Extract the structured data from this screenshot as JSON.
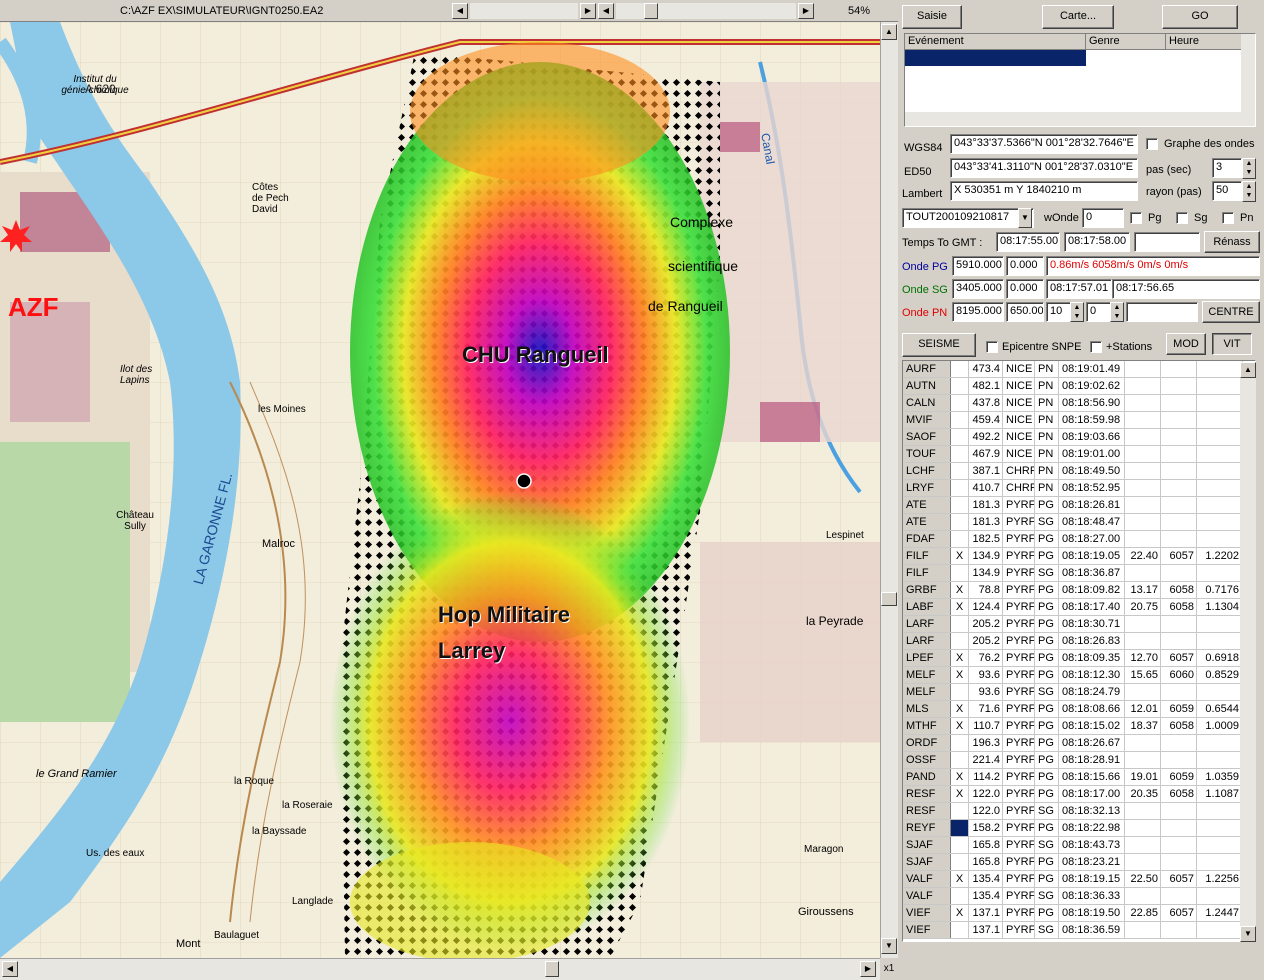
{
  "titlebar": {
    "path": "C:\\AZF EX\\SIMULATEUR\\IGNT0250.EA2",
    "zoom": "54%",
    "zoom_factor": "x1"
  },
  "map": {
    "labels": {
      "azf": "AZF",
      "chu": "CHU Rangueil",
      "hop1": "Hop Militaire",
      "hop2": "Larrey",
      "garonne": "LA GARONNE FL.",
      "a620": "A 620",
      "institut": "Institut du génie chimique",
      "ilot": "Ilot des Lapins",
      "chateau": "Château Sully",
      "malroc": "Malroc",
      "moines": "les Moines",
      "laroque": "la Roque",
      "roseraie": "la Roseraie",
      "bayssade": "la Bayssade",
      "grandramier": "le Grand Ramier",
      "baulaguet": "Baulaguet",
      "langlade": "Langlade",
      "giroussens": "Giroussens",
      "maragon": "Maragon",
      "peyrade": "la Peyrade",
      "lespinet": "Lespinet",
      "complexe": "Complexe",
      "scientifique": "scientifique",
      "rangueil": "de Rangueil",
      "canal": "Canal",
      "cotes": "Côtes de Pech David",
      "usdeseaux": "Us. des eaux",
      "mont": "Mont"
    }
  },
  "buttons": {
    "saisie": "Saisie",
    "carte": "Carte...",
    "go": "GO",
    "renass": "Rénass",
    "centre": "CENTRE",
    "seisme": "SEISME",
    "mod": "MOD",
    "vit": "VIT"
  },
  "events": {
    "col_event": "Evénement",
    "col_genre": "Genre",
    "col_heure": "Heure"
  },
  "coords": {
    "wgs84_label": "WGS84",
    "wgs84": "043°33'37.5366\"N 001°28'32.7646\"E",
    "ed50_label": "ED50",
    "ed50": "043°33'41.3110\"N 001°28'37.0310\"E",
    "lambert_label": "Lambert",
    "lambert": "X 530351 m Y 1840210 m",
    "graphe": "Graphe des ondes",
    "pas_label": "pas (sec)",
    "pas": "3",
    "rayon_label": "rayon (pas)",
    "rayon": "50"
  },
  "filter": {
    "select": "TOUT200109210817",
    "wonde_label": "wOnde",
    "wonde": "0",
    "pg": "Pg",
    "sg": "Sg",
    "pn": "Pn"
  },
  "time": {
    "label": "Temps To GMT :",
    "t1": "08:17:55.00",
    "t2": "08:17:58.00"
  },
  "onde_pg": {
    "label": "Onde PG",
    "v1": "5910.000",
    "v2": "0.000",
    "info": "0.86m/s 6058m/s 0m/s 0m/s"
  },
  "onde_sg": {
    "label": "Onde SG",
    "v1": "3405.000",
    "v2": "0.000",
    "t1": "08:17:57.01",
    "t2": "08:17:56.65"
  },
  "onde_pn": {
    "label": "Onde PN",
    "v1": "8195.000",
    "v2": "650.00",
    "s1": "10",
    "s2": "0"
  },
  "options": {
    "epicentre": "Epicentre SNPE",
    "stations": "+Stations"
  },
  "stations": [
    [
      "AURF",
      "",
      "473.4",
      "NICE",
      "PN",
      "08:19:01.49",
      "",
      "",
      ""
    ],
    [
      "AUTN",
      "",
      "482.1",
      "NICE",
      "PN",
      "08:19:02.62",
      "",
      "",
      ""
    ],
    [
      "CALN",
      "",
      "437.8",
      "NICE",
      "PN",
      "08:18:56.90",
      "",
      "",
      ""
    ],
    [
      "MVIF",
      "",
      "459.4",
      "NICE",
      "PN",
      "08:18:59.98",
      "",
      "",
      ""
    ],
    [
      "SAOF",
      "",
      "492.2",
      "NICE",
      "PN",
      "08:19:03.66",
      "",
      "",
      ""
    ],
    [
      "TOUF",
      "",
      "467.9",
      "NICE",
      "PN",
      "08:19:01.00",
      "",
      "",
      ""
    ],
    [
      "LCHF",
      "",
      "387.1",
      "CHRF",
      "PN",
      "08:18:49.50",
      "",
      "",
      ""
    ],
    [
      "LRYF",
      "",
      "410.7",
      "CHRF",
      "PN",
      "08:18:52.95",
      "",
      "",
      ""
    ],
    [
      "ATE",
      "",
      "181.3",
      "PYRF",
      "PG",
      "08:18:26.81",
      "",
      "",
      ""
    ],
    [
      "ATE",
      "",
      "181.3",
      "PYRF",
      "SG",
      "08:18:48.47",
      "",
      "",
      ""
    ],
    [
      "FDAF",
      "",
      "182.5",
      "PYRF",
      "PG",
      "08:18:27.00",
      "",
      "",
      ""
    ],
    [
      "FILF",
      "X",
      "134.9",
      "PYRF",
      "PG",
      "08:18:19.05",
      "22.40",
      "6057",
      "1.2202"
    ],
    [
      "FILF",
      "",
      "134.9",
      "PYRF",
      "SG",
      "08:18:36.87",
      "",
      "",
      ""
    ],
    [
      "GRBF",
      "X",
      "78.8",
      "PYRF",
      "PG",
      "08:18:09.82",
      "13.17",
      "6058",
      "0.7176"
    ],
    [
      "LABF",
      "X",
      "124.4",
      "PYRF",
      "PG",
      "08:18:17.40",
      "20.75",
      "6058",
      "1.1304"
    ],
    [
      "LARF",
      "",
      "205.2",
      "PYRF",
      "PG",
      "08:18:30.71",
      "",
      "",
      ""
    ],
    [
      "LARF",
      "",
      "205.2",
      "PYRF",
      "PG",
      "08:18:26.83",
      "",
      "",
      ""
    ],
    [
      "LPEF",
      "X",
      "76.2",
      "PYRF",
      "PG",
      "08:18:09.35",
      "12.70",
      "6057",
      "0.6918"
    ],
    [
      "MELF",
      "X",
      "93.6",
      "PYRF",
      "PG",
      "08:18:12.30",
      "15.65",
      "6060",
      "0.8529"
    ],
    [
      "MELF",
      "",
      "93.6",
      "PYRF",
      "SG",
      "08:18:24.79",
      "",
      "",
      ""
    ],
    [
      "MLS",
      "X",
      "71.6",
      "PYRF",
      "PG",
      "08:18:08.66",
      "12.01",
      "6059",
      "0.6544"
    ],
    [
      "MTHF",
      "X",
      "110.7",
      "PYRF",
      "PG",
      "08:18:15.02",
      "18.37",
      "6058",
      "1.0009"
    ],
    [
      "ORDF",
      "",
      "196.3",
      "PYRF",
      "PG",
      "08:18:26.67",
      "",
      "",
      ""
    ],
    [
      "OSSF",
      "",
      "221.4",
      "PYRF",
      "PG",
      "08:18:28.91",
      "",
      "",
      ""
    ],
    [
      "PAND",
      "X",
      "114.2",
      "PYRF",
      "PG",
      "08:18:15.66",
      "19.01",
      "6059",
      "1.0359"
    ],
    [
      "RESF",
      "X",
      "122.0",
      "PYRF",
      "PG",
      "08:18:17.00",
      "20.35",
      "6058",
      "1.1087"
    ],
    [
      "RESF",
      "",
      "122.0",
      "PYRF",
      "SG",
      "08:18:32.13",
      "",
      "",
      ""
    ],
    [
      "REYF",
      "",
      "158.2",
      "PYRF",
      "PG",
      "08:18:22.98",
      "",
      "",
      ""
    ],
    [
      "SJAF",
      "",
      "165.8",
      "PYRF",
      "SG",
      "08:18:43.73",
      "",
      "",
      ""
    ],
    [
      "SJAF",
      "",
      "165.8",
      "PYRF",
      "PG",
      "08:18:23.21",
      "",
      "",
      ""
    ],
    [
      "VALF",
      "X",
      "135.4",
      "PYRF",
      "PG",
      "08:18:19.15",
      "22.50",
      "6057",
      "1.2256"
    ],
    [
      "VALF",
      "",
      "135.4",
      "PYRF",
      "SG",
      "08:18:36.33",
      "",
      "",
      ""
    ],
    [
      "VIEF",
      "X",
      "137.1",
      "PYRF",
      "PG",
      "08:18:19.50",
      "22.85",
      "6057",
      "1.2447"
    ],
    [
      "VIEF",
      "",
      "137.1",
      "PYRF",
      "SG",
      "08:18:36.59",
      "",
      "",
      ""
    ]
  ]
}
